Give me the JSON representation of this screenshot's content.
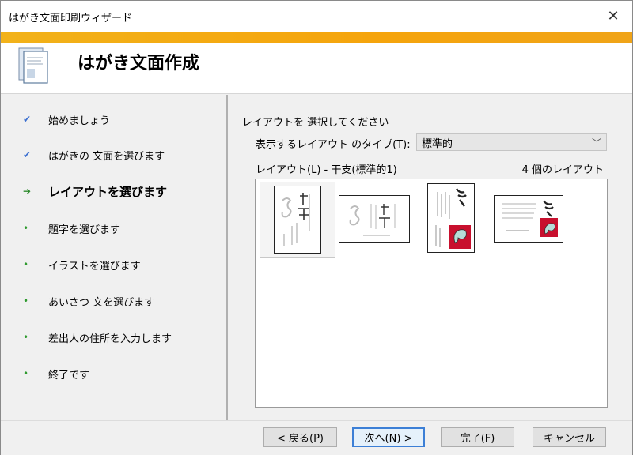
{
  "window": {
    "title": "はがき文面印刷ウィザード",
    "close_glyph": "✕"
  },
  "header": {
    "title": "はがき文面作成",
    "icon": "postcard-wizard-icon"
  },
  "sidebar": {
    "steps": [
      {
        "label": "始めましょう",
        "state": "done",
        "mark": "✔"
      },
      {
        "label": "はがきの 文面を選びます",
        "state": "done",
        "mark": "✔"
      },
      {
        "label": "レイアウトを選びます",
        "state": "current",
        "mark": "➔"
      },
      {
        "label": "題字を選びます",
        "state": "todo",
        "mark": "•"
      },
      {
        "label": "イラストを選びます",
        "state": "todo",
        "mark": "•"
      },
      {
        "label": "あいさつ 文を選びます",
        "state": "todo",
        "mark": "•"
      },
      {
        "label": "差出人の住所を入力します",
        "state": "todo",
        "mark": "•"
      },
      {
        "label": "終了です",
        "state": "todo",
        "mark": "•"
      }
    ]
  },
  "main": {
    "instruction": "レイアウトを 選択してください",
    "type_label": "表示するレイアウト のタイプ(T):",
    "type_value": "標準的",
    "chevron": "﹀",
    "layout_label": "レイアウト(L) - 干支(標準的1)",
    "layout_count": "4 個のレイアウト",
    "thumbnails": [
      {
        "name": "layout-1",
        "orientation": "portrait",
        "selected": true
      },
      {
        "name": "layout-2",
        "orientation": "landscape",
        "selected": false
      },
      {
        "name": "layout-3",
        "orientation": "portrait",
        "selected": false
      },
      {
        "name": "layout-4",
        "orientation": "landscape",
        "selected": false
      }
    ]
  },
  "footer": {
    "back": "< 戻る(P)",
    "next": "次へ(N) >",
    "finish": "完了(F)",
    "cancel": "キャンセル"
  },
  "colors": {
    "accent": "#f5a40c",
    "check": "#3b6fd0",
    "bullet": "#2e9a2e",
    "default_button_border": "#3c7fd6",
    "red_illustration": "#c8102e"
  }
}
